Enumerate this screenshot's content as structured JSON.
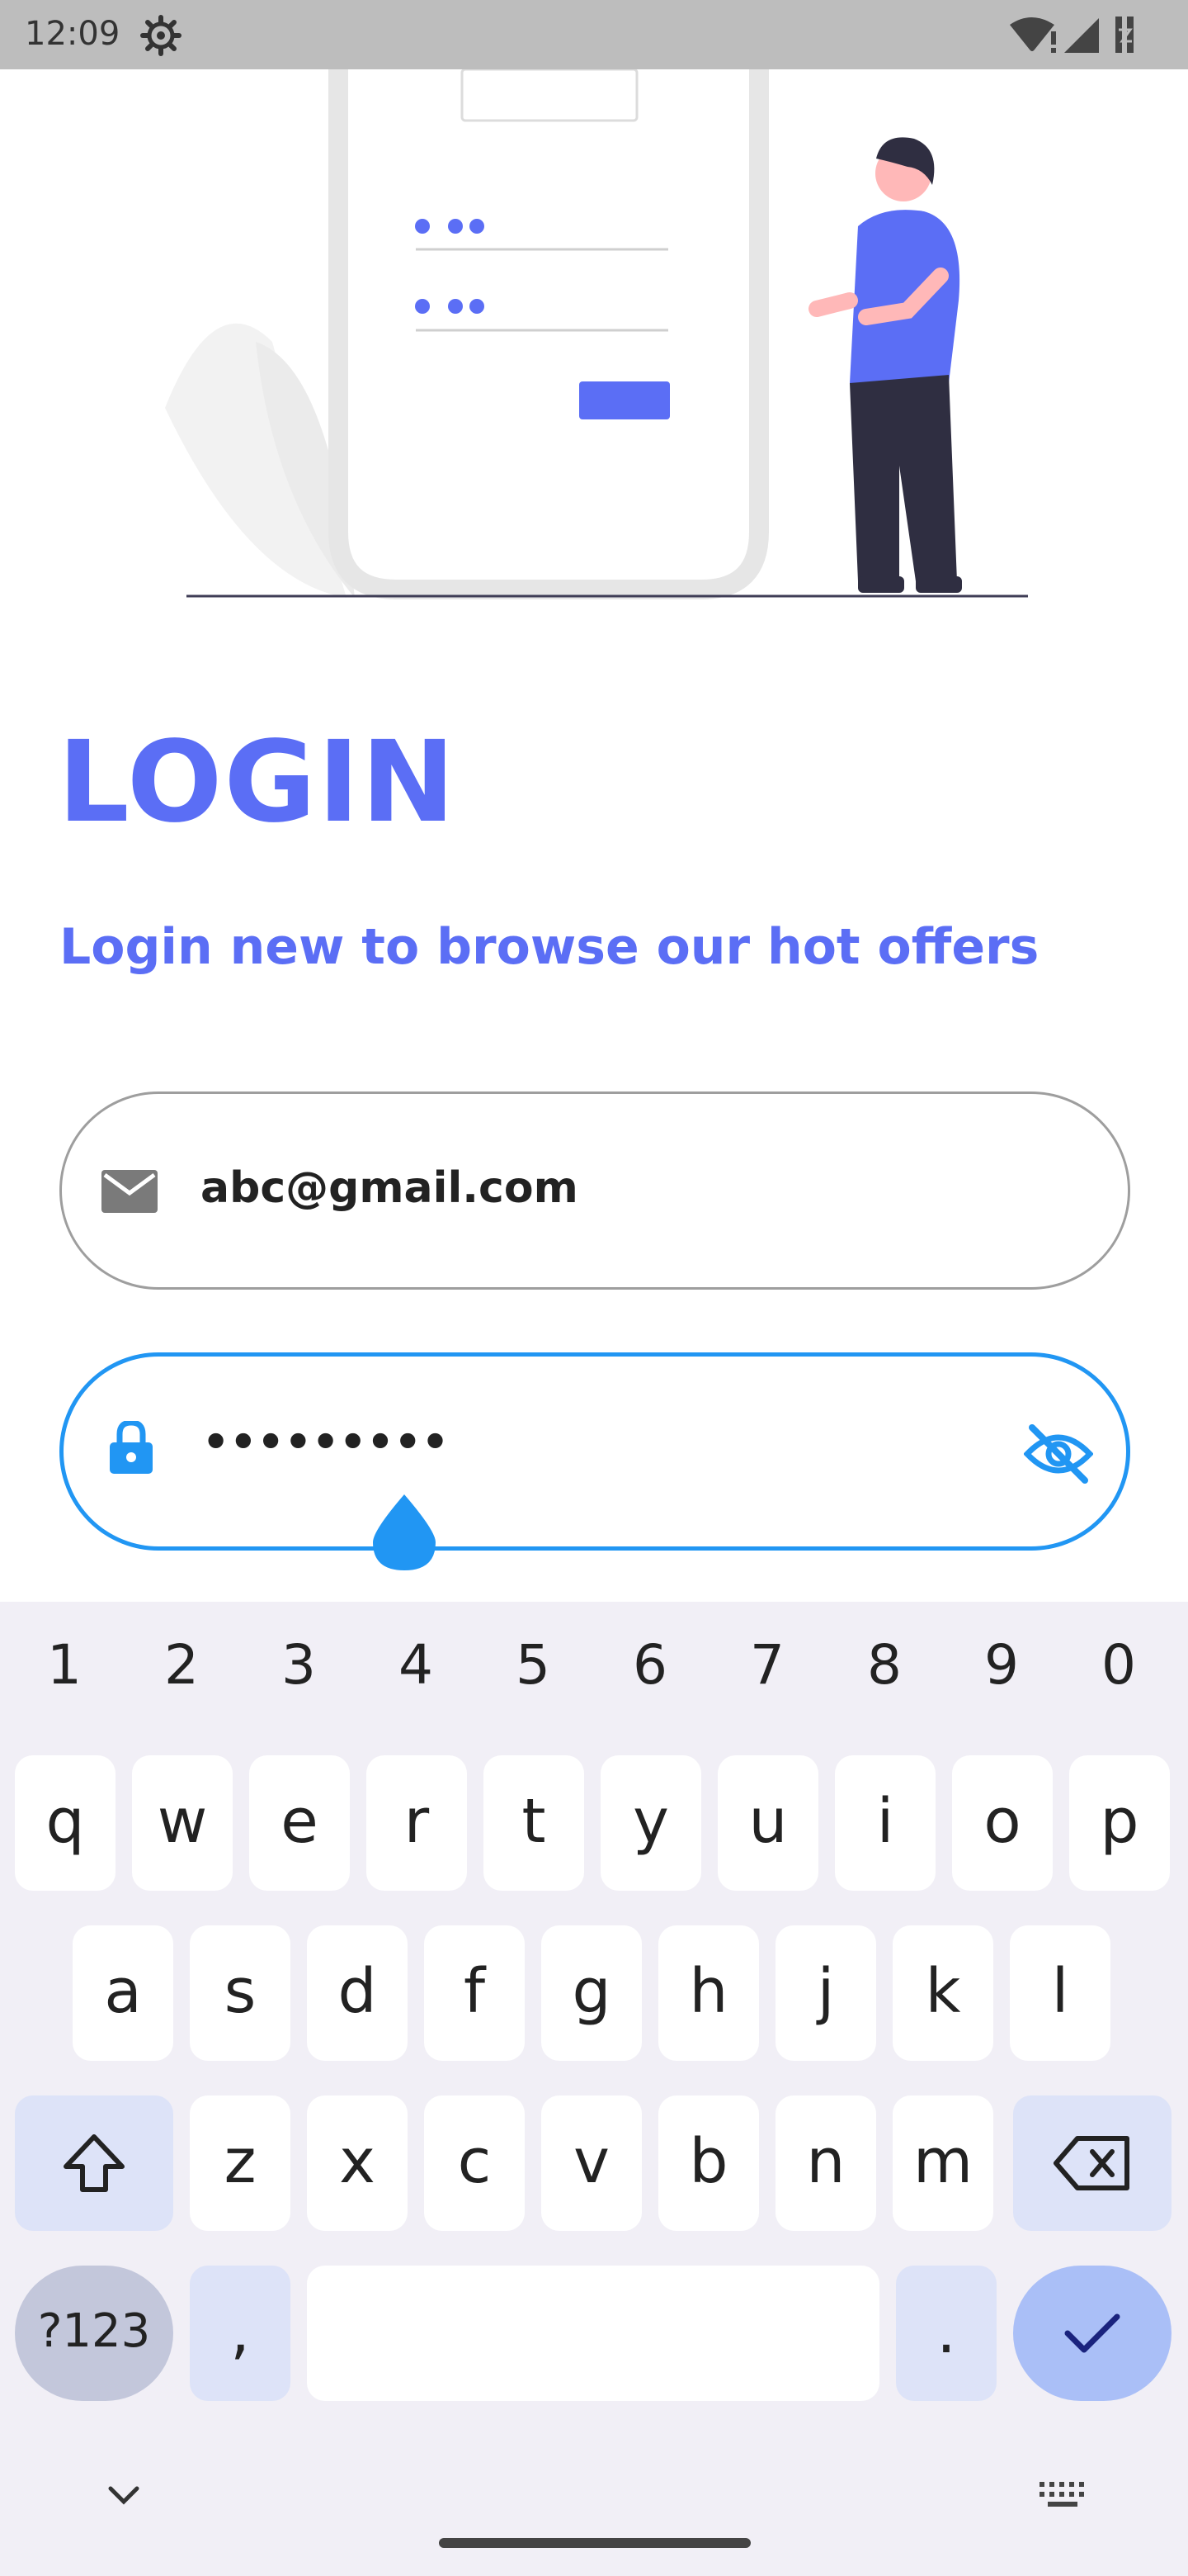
{
  "status_bar": {
    "time": "12:09",
    "icons": [
      "settings-gear-icon",
      "wifi-icon",
      "signal-icon",
      "battery-charging-icon"
    ]
  },
  "login": {
    "title": "LOGIN",
    "subtitle": "Login new to browse our hot offers"
  },
  "form": {
    "email": {
      "value": "abc@gmail.com",
      "icon": "mail-icon"
    },
    "password": {
      "value": "•••••••••",
      "icon": "lock-icon",
      "toggle_icon": "eye-off-icon"
    }
  },
  "keyboard": {
    "numbers": [
      "1",
      "2",
      "3",
      "4",
      "5",
      "6",
      "7",
      "8",
      "9",
      "0"
    ],
    "row1": [
      "q",
      "w",
      "e",
      "r",
      "t",
      "y",
      "u",
      "i",
      "o",
      "p"
    ],
    "row2": [
      "a",
      "s",
      "d",
      "f",
      "g",
      "h",
      "j",
      "k",
      "l"
    ],
    "row3": [
      "z",
      "x",
      "c",
      "v",
      "b",
      "n",
      "m"
    ],
    "symbols_label": "?123",
    "comma_label": ",",
    "period_label": "."
  },
  "colors": {
    "accent": "#5b6ef5",
    "focus": "#2196f3",
    "keyboard_bg": "#f1eff6"
  }
}
